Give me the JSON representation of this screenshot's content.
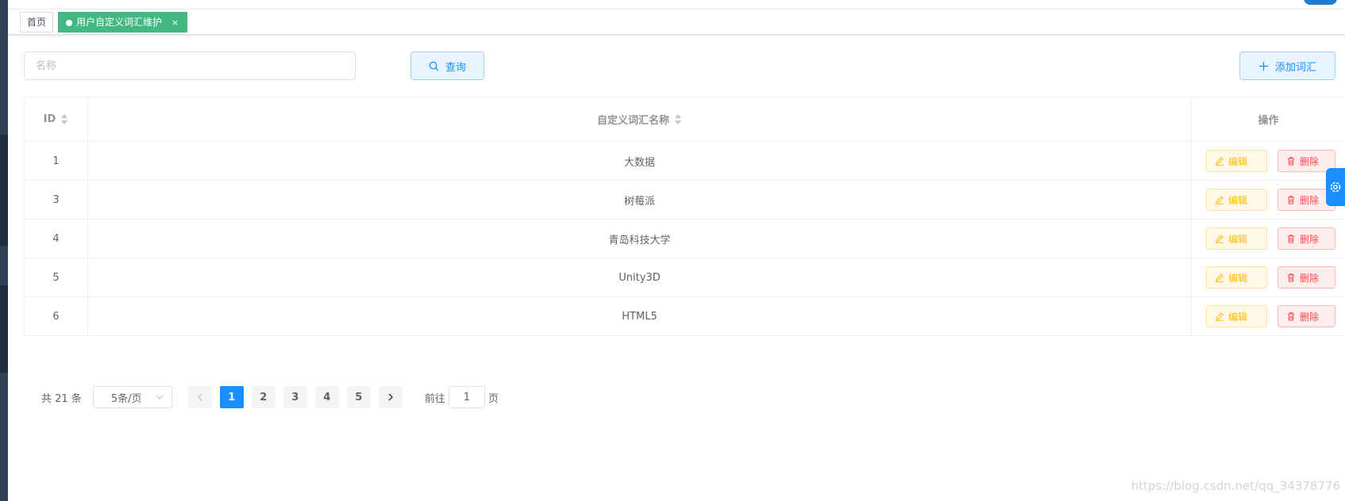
{
  "colors": {
    "primary": "#1890ff",
    "tag_active": "#42b983",
    "edit": "#ffba00",
    "delete": "#ff4949"
  },
  "tags": {
    "home": "首页",
    "active": "用户自定义词汇维护",
    "close": "×"
  },
  "search": {
    "placeholder": "名称",
    "query_label": "查询",
    "query_icon": "search-icon"
  },
  "toolbar": {
    "add_label": "添加词汇",
    "add_icon": "plus-icon"
  },
  "table": {
    "headers": {
      "id": "ID",
      "name": "自定义词汇名称",
      "actions": "操作"
    },
    "rows": [
      {
        "id": "1",
        "name": "大数据"
      },
      {
        "id": "3",
        "name": "树莓派"
      },
      {
        "id": "4",
        "name": "青岛科技大学"
      },
      {
        "id": "5",
        "name": "Unity3D"
      },
      {
        "id": "6",
        "name": "HTML5"
      }
    ],
    "edit_label": "编辑",
    "delete_label": "删除"
  },
  "pagination": {
    "total": "共 21 条",
    "page_size": "5条/页",
    "pages": [
      "1",
      "2",
      "3",
      "4",
      "5"
    ],
    "current_page": 1,
    "goto_prefix": "前往",
    "goto_value": "1",
    "goto_suffix": "页"
  },
  "watermark": "https://blog.csdn.net/qq_34378776"
}
